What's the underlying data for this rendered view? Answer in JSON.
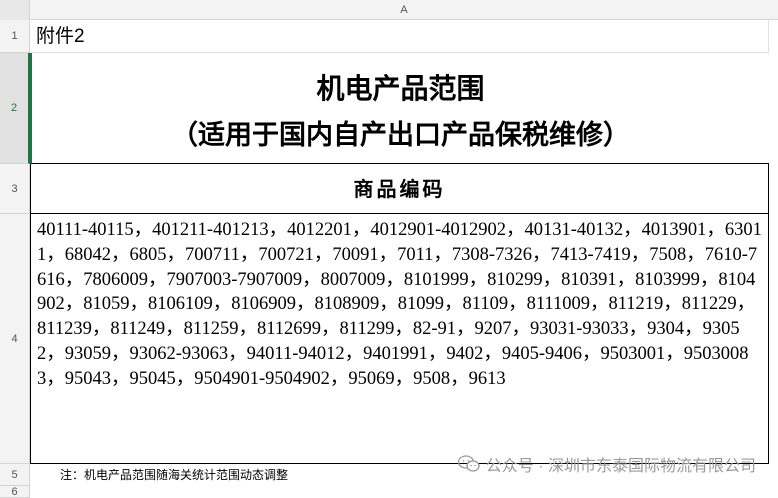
{
  "sheet": {
    "column_label": "A",
    "rows": [
      "1",
      "2",
      "3",
      "4",
      "5",
      "6"
    ]
  },
  "cells": {
    "r1": "附件2",
    "r2_line1": "机电产品范围",
    "r2_line2": "（适用于国内自产出口产品保税维修）",
    "r3": "商品编码",
    "r4": "40111-40115，401211-401213，4012201，4012901-4012902，40131-40132，4013901，63011，68042，6805，700711，700721，70091，7011，7308-7326，7413-7419，7508，7610-7616，7806009，7907003-7907009，8007009，8101999，810299，810391，8103999，8104902，81059，8106109，8106909，8108909，81099，81109，8111009，811219，811229，811239，811249，811259，8112699，811299，82-91，9207，93031-93033，9304，93052，93059，93062-93063，94011-94012，9401991，9402，9405-9406，9503001，95030083，95043，95045，9504901-9504902，95069，9508，9613",
    "r5": "注：机电产品范围随海关统计范围动态调整"
  },
  "watermark": {
    "text": "公众号 · 深圳市东泰国际物流有限公司",
    "icon": "wechat-icon"
  }
}
